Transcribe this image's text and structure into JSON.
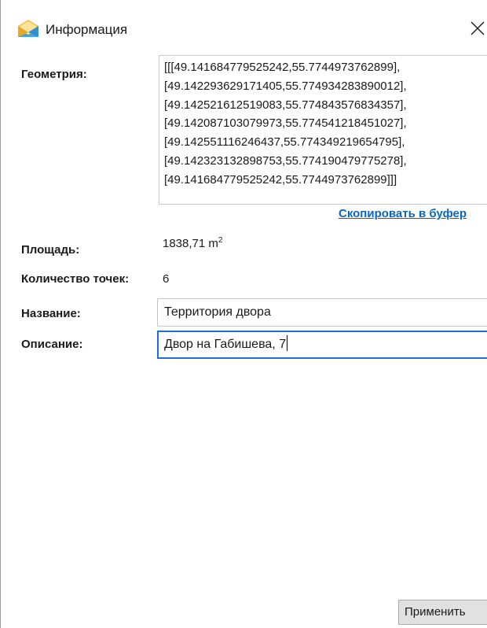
{
  "window": {
    "title": "Информация",
    "close_glyph": "✕",
    "icon": "envelope-icon"
  },
  "fields": {
    "geometry_label": "Геометрия:",
    "geometry_lines": [
      "[[[49.141684779525242,55.7744973762899],",
      "[49.142293629171405,55.774934283890012],",
      "[49.142521612519083,55.774843576834357],",
      "[49.142087103079973,55.774541218451027],",
      "[49.142551116246437,55.774349219654795],",
      "[49.142323132898753,55.774190479775278],",
      "[49.141684779525242,55.7744973762899]]]"
    ],
    "copy_link": "Скопировать в буфер",
    "area_label": "Площадь:",
    "area_value": "1838,71 m",
    "area_unit_sup": "2",
    "points_label": "Количество точек:",
    "points_value": "6",
    "name_label": "Название:",
    "name_value": "Территория двора",
    "description_label": "Описание:",
    "description_value": "Двор на Габишева, 7"
  },
  "buttons": {
    "apply": "Применить"
  },
  "colors": {
    "link": "#0a66c2",
    "focus_border": "#1f6ed4",
    "button_bg": "#e1e1e1",
    "icon_yellow": "#f5c33b",
    "icon_blue": "#4aa3df"
  }
}
